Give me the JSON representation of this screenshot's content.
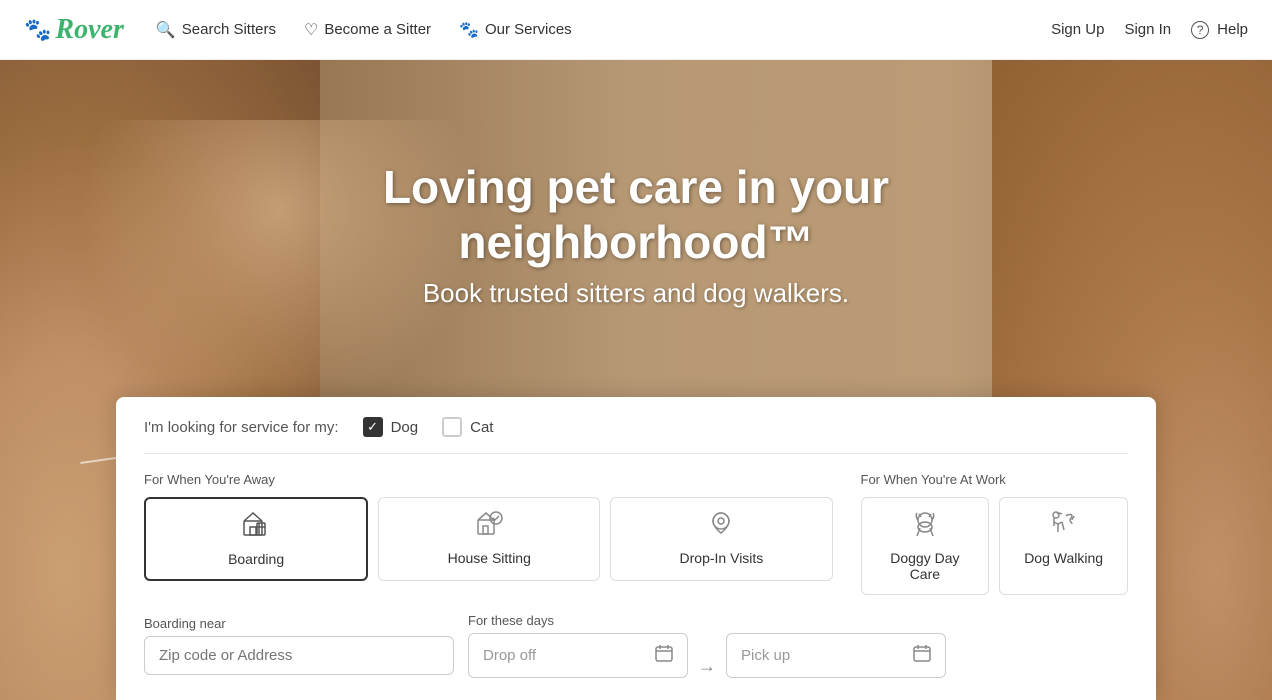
{
  "logo": {
    "paw_icon": "🐾",
    "text": "Rover"
  },
  "nav": {
    "links": [
      {
        "icon": "🔍",
        "label": "Search Sitters"
      },
      {
        "icon": "♡",
        "label": "Become a Sitter"
      },
      {
        "icon": "🐾",
        "label": "Our Services"
      }
    ],
    "right": [
      {
        "label": "Sign Up"
      },
      {
        "label": "Sign In"
      },
      {
        "icon": "?",
        "label": "Help"
      }
    ]
  },
  "hero": {
    "headline": "Loving pet care in your neighborhood™",
    "subheadline": "Book trusted sitters and dog walkers."
  },
  "search_panel": {
    "pet_selector_label": "I'm looking for service for my:",
    "pet_options": [
      {
        "label": "Dog",
        "checked": true
      },
      {
        "label": "Cat",
        "checked": false
      }
    ],
    "categories": [
      {
        "label": "For When You're Away",
        "services": [
          {
            "icon": "🏠",
            "name": "Boarding",
            "active": true
          },
          {
            "icon": "🏡",
            "name": "House Sitting",
            "active": false
          },
          {
            "icon": "🚶",
            "name": "Drop-In Visits",
            "active": false
          }
        ]
      },
      {
        "label": "For When You're At Work",
        "services": [
          {
            "icon": "☀️",
            "name": "Doggy Day Care",
            "active": false
          },
          {
            "icon": "🐾",
            "name": "Dog Walking",
            "active": false
          }
        ]
      }
    ],
    "location": {
      "label": "Boarding near",
      "placeholder": "Zip code or Address"
    },
    "dates": {
      "label": "For these days",
      "drop_off_placeholder": "Drop off",
      "pick_up_placeholder": "Pick up"
    }
  }
}
